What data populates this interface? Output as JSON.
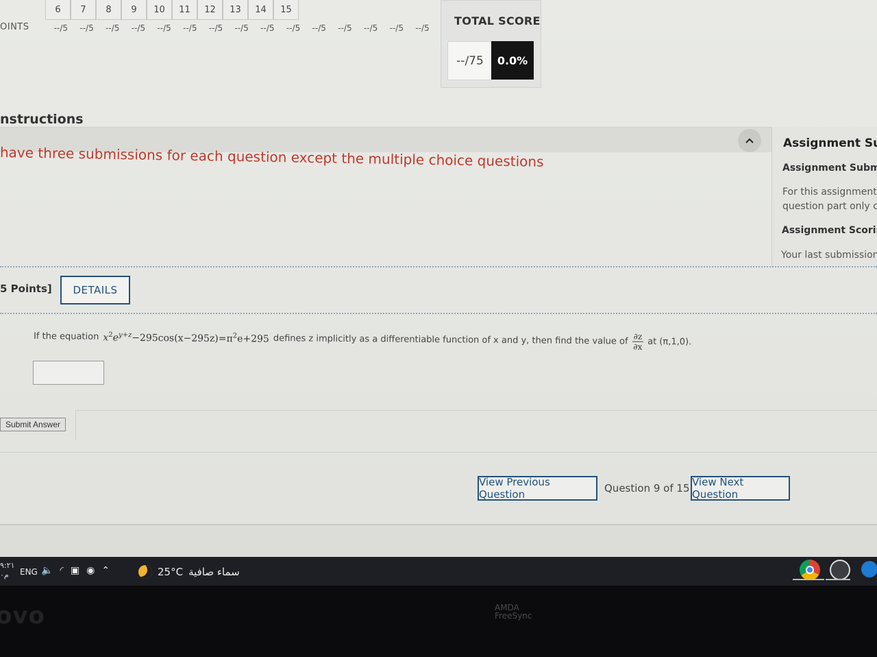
{
  "score_grid": {
    "question_numbers": [
      "6",
      "7",
      "8",
      "9",
      "10",
      "11",
      "12",
      "13",
      "14",
      "15"
    ],
    "points_label": "OINTS",
    "points": [
      "--/5",
      "--/5",
      "--/5",
      "--/5",
      "--/5",
      "--/5",
      "--/5",
      "--/5",
      "--/5",
      "--/5",
      "--/5",
      "--/5",
      "--/5",
      "--/5",
      "--/5"
    ]
  },
  "total_score": {
    "title": "TOTAL SCORE",
    "value": "--/75",
    "percent": "0.0%"
  },
  "instructions": {
    "title": "nstructions",
    "text": "have three submissions for each question except the multiple choice questions"
  },
  "side_panel": {
    "title": "Assignment Subm",
    "subtitle_1": "Assignment Submis",
    "para_1_line1": "For this assignment, y",
    "para_1_line2": "question part only cha",
    "subtitle_2": "Assignment Scoring",
    "para_2": "Your last submission i"
  },
  "question": {
    "points": "5 Points]",
    "details_label": "DETAILS",
    "text_before": "If the equation",
    "eq_x2": "x",
    "eq_sup1": "2",
    "eq_e": "e",
    "eq_sup2": "y+z",
    "eq_rest": "−295cos(x−295z)=π",
    "eq_sup3": "2",
    "eq_end": "e+295",
    "text_mid": "defines z implicitly as a differentiable function of x and y, then find the value of",
    "frac_num": "∂z",
    "frac_den": "∂x",
    "text_after": "at (π,1,0).",
    "answer_value": ""
  },
  "actions": {
    "submit_label": "Submit Answer"
  },
  "navigation": {
    "previous_label": "View Previous Question",
    "position": "Question 9 of 15",
    "next_label": "View Next Question"
  },
  "taskbar": {
    "time": "٩:٢١",
    "time_line2": "م٠",
    "language": "ENG",
    "weather_temp": "25°C",
    "weather_desc": "سماء صافية",
    "icons": [
      "volume-icon",
      "wifi-icon",
      "meet-icon",
      "record-icon",
      "chevron-up-icon"
    ],
    "apps": [
      "chrome-icon",
      "overwolf-icon",
      "edge-icon"
    ]
  },
  "bezel": {
    "brand": "ovo",
    "amd": "AMDA",
    "freesync": "FreeSync"
  },
  "colors": {
    "link_blue": "#23527c",
    "instruction_red": "#c0392b",
    "dark_cell": "#141414"
  }
}
